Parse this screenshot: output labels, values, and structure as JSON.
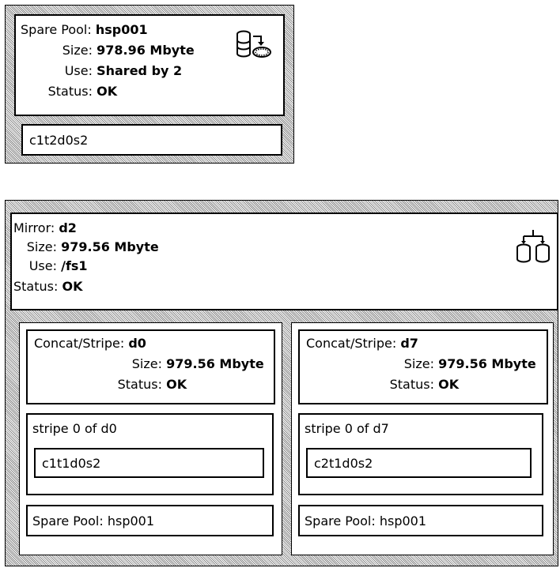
{
  "spare_pool_panel": {
    "pool_label": "Spare Pool:",
    "pool_value": "hsp001",
    "size_label": "Size:",
    "size_value": "978.96 Mbyte",
    "use_label": "Use:",
    "use_value": "Shared by 2",
    "status_label": "Status:",
    "status_value": "OK",
    "icon": "hot-spare-pool-icon",
    "slice": "c1t2d0s2"
  },
  "mirror_panel": {
    "mirror_label": "Mirror:",
    "mirror_value": "d2",
    "size_label": "Size:",
    "size_value": "979.56 Mbyte",
    "use_label": "Use:",
    "use_value": "/fs1",
    "status_label": "Status:",
    "status_value": "OK",
    "icon": "mirror-icon",
    "submirrors": [
      {
        "cs_label": "Concat/Stripe:",
        "cs_value": "d0",
        "size_label": "Size:",
        "size_value": "979.56 Mbyte",
        "status_label": "Status:",
        "status_value": "OK",
        "stripe_title": "stripe 0 of d0",
        "slice": "c1t1d0s2",
        "spare_pool": "Spare Pool: hsp001"
      },
      {
        "cs_label": "Concat/Stripe:",
        "cs_value": "d7",
        "size_label": "Size:",
        "size_value": "979.56 Mbyte",
        "status_label": "Status:",
        "status_value": "OK",
        "stripe_title": "stripe 0 of d7",
        "slice": "c2t1d0s2",
        "spare_pool": "Spare Pool: hsp001"
      }
    ]
  }
}
